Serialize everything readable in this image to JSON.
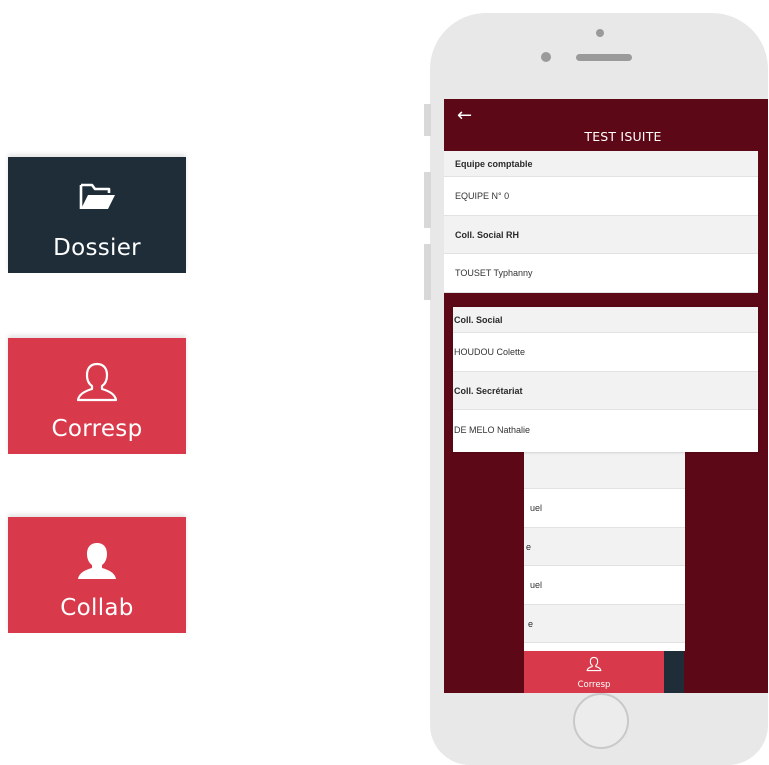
{
  "tiles": [
    {
      "label": "Dossier",
      "icon": "folder-open-icon",
      "color": "#1e2d38"
    },
    {
      "label": "Corresp",
      "icon": "user-outline-icon",
      "color": "#d93a4b"
    },
    {
      "label": "Collab",
      "icon": "user-filled-icon",
      "color": "#d93a4b"
    }
  ],
  "app": {
    "title": "TEST ISUITE",
    "back_icon": "back-arrow-icon",
    "header_color": "#5d0816"
  },
  "list": [
    {
      "type": "header",
      "text": "Equipe comptable"
    },
    {
      "type": "item",
      "text": "EQUIPE N° 0"
    },
    {
      "type": "header",
      "text": "Coll. Social RH"
    },
    {
      "type": "item",
      "text": "TOUSET Typhanny"
    }
  ],
  "popup": [
    {
      "type": "header",
      "text": "Coll. Social"
    },
    {
      "type": "item",
      "text": "HOUDOU Colette"
    },
    {
      "type": "header",
      "text": "Coll. Secrétariat"
    },
    {
      "type": "item",
      "text": "DE MELO Nathalie"
    }
  ],
  "under": [
    {
      "type": "header",
      "text": ""
    },
    {
      "type": "item",
      "text": "uel"
    },
    {
      "type": "header",
      "text": "e"
    },
    {
      "type": "item",
      "text": "uel"
    },
    {
      "type": "header",
      "text": "e"
    }
  ],
  "bottom_nav": {
    "label": "Corresp",
    "icon": "user-outline-icon"
  }
}
